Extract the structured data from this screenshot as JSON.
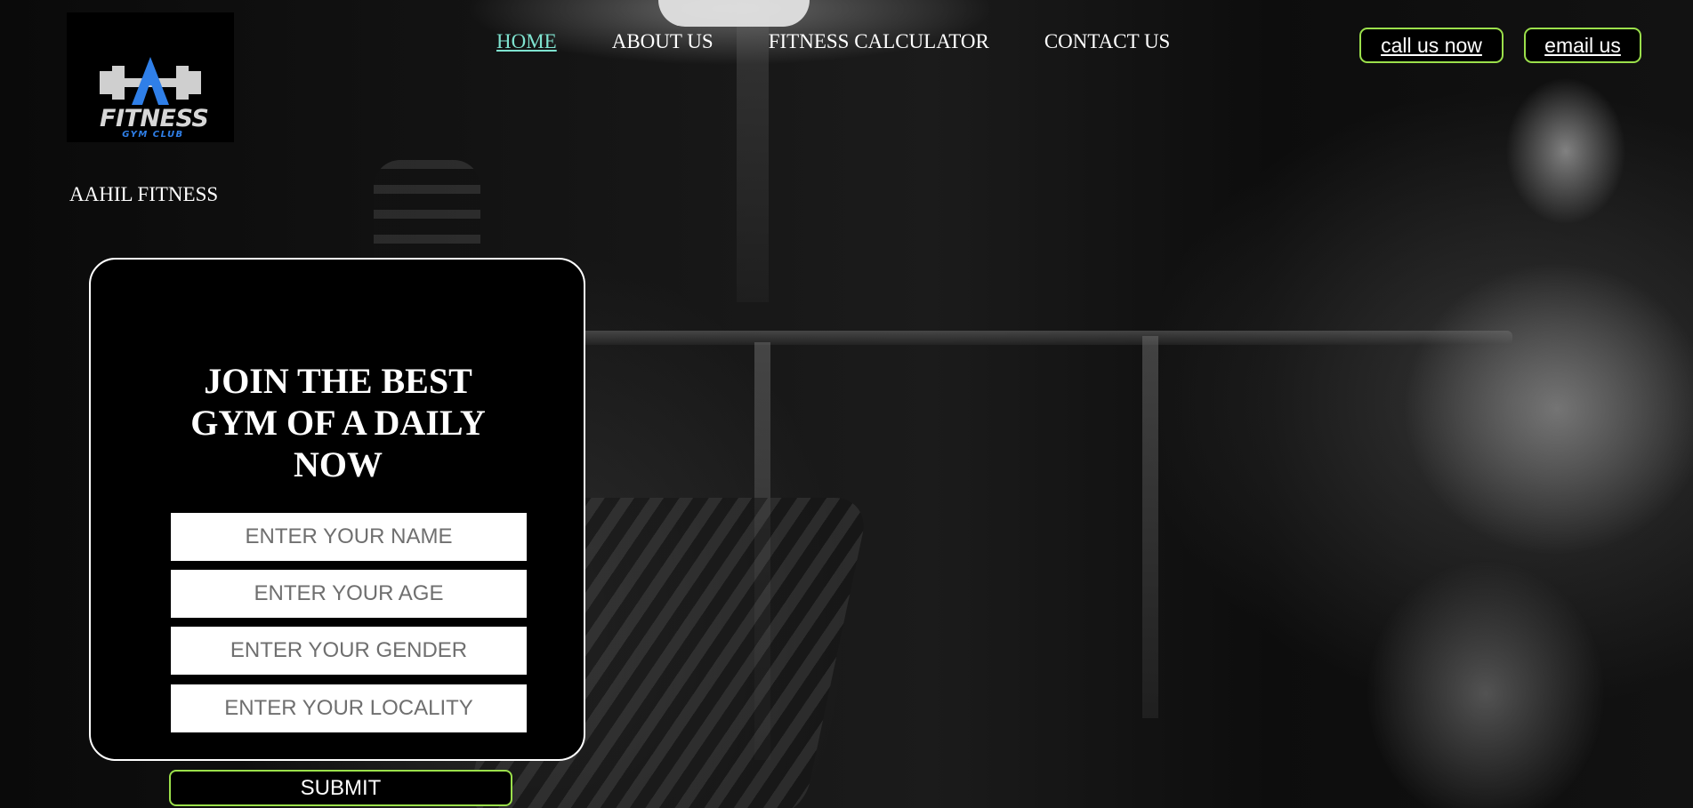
{
  "brand": {
    "logo_text": "FITNESS",
    "logo_subtext": "GYM CLUB",
    "name": "AAHIL FITNESS",
    "logo_colors": {
      "mark": "#2f7fe8",
      "text": "#d7d7d7"
    }
  },
  "nav": {
    "items": [
      {
        "label": "HOME",
        "active": true
      },
      {
        "label": "ABOUT US",
        "active": false
      },
      {
        "label": "FITNESS CALCULATOR",
        "active": false
      },
      {
        "label": "CONTACT US",
        "active": false
      }
    ],
    "active_color": "#7fe3d0"
  },
  "header_actions": {
    "call_label": "call us now",
    "email_label": "email us",
    "border_color": "#9be04b"
  },
  "form": {
    "title": "JOIN THE BEST GYM OF A DAILY NOW",
    "fields": {
      "name": {
        "placeholder": "ENTER YOUR NAME",
        "value": ""
      },
      "age": {
        "placeholder": "ENTER YOUR AGE",
        "value": ""
      },
      "gender": {
        "placeholder": "ENTER YOUR GENDER",
        "value": ""
      },
      "locality": {
        "placeholder": "ENTER YOUR LOCALITY",
        "value": ""
      }
    },
    "submit_label": "SUBMIT"
  }
}
